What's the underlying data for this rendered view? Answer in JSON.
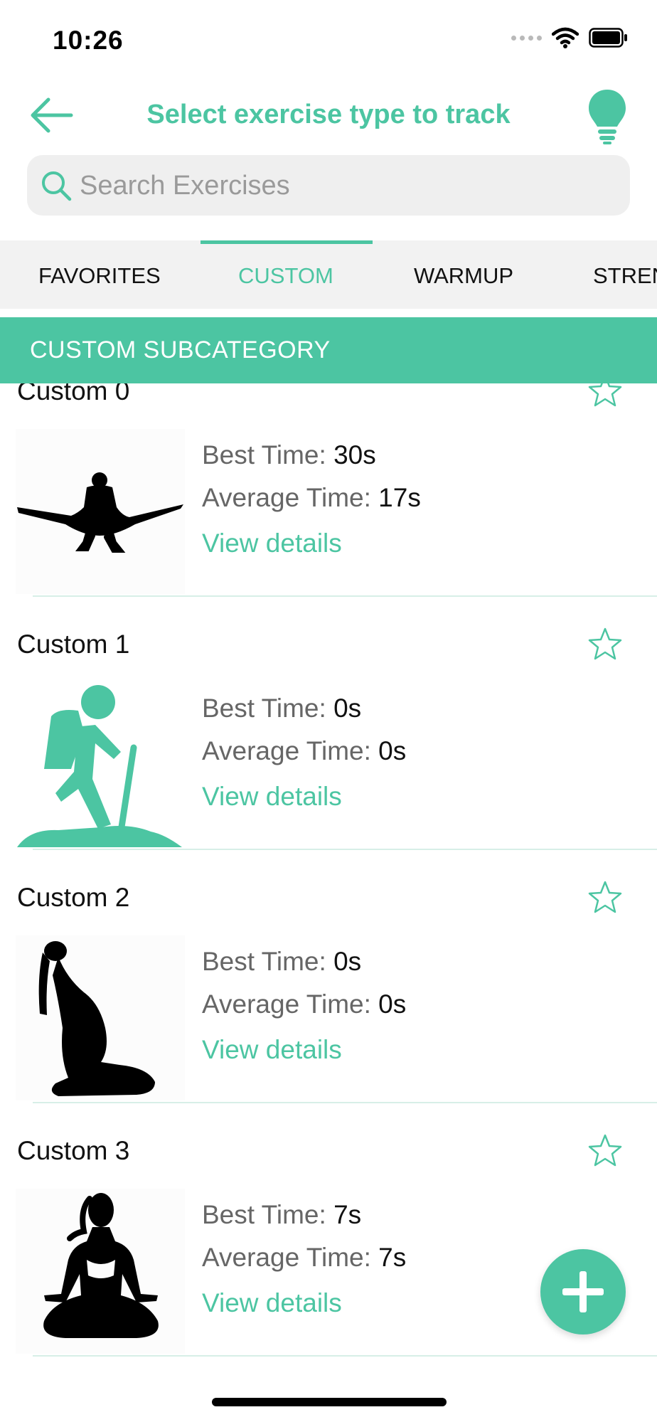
{
  "status_bar": {
    "time": "10:26"
  },
  "header": {
    "title": "Select exercise type to track",
    "back_icon": "arrow-left-icon",
    "hint_icon": "lightbulb-icon"
  },
  "search": {
    "placeholder": "Search Exercises",
    "value": ""
  },
  "tabs": [
    {
      "label": "FAVORITES",
      "active": false
    },
    {
      "label": "CUSTOM",
      "active": true
    },
    {
      "label": "WARMUP",
      "active": false
    },
    {
      "label": "STREN",
      "active": false
    }
  ],
  "subcategory": {
    "label": "CUSTOM SUBCATEGORY"
  },
  "stat_labels": {
    "best": "Best Time:",
    "average": "Average Time:"
  },
  "exercises": [
    {
      "name": "Custom 0",
      "best_time": "30s",
      "average_time": "17s",
      "details": "View details",
      "image": "split-pose-silhouette"
    },
    {
      "name": "Custom 1",
      "best_time": "0s",
      "average_time": "0s",
      "details": "View details",
      "image": "hiker-icon"
    },
    {
      "name": "Custom 2",
      "best_time": "0s",
      "average_time": "0s",
      "details": "View details",
      "image": "kneeling-stretch-silhouette"
    },
    {
      "name": "Custom 3",
      "best_time": "7s",
      "average_time": "7s",
      "details": "View details",
      "image": "meditation-silhouette"
    }
  ],
  "colors": {
    "accent": "#4cc5a2",
    "tab_bg": "#f2f2f2",
    "search_bg": "#efefef"
  },
  "fab": {
    "icon": "plus-icon"
  }
}
